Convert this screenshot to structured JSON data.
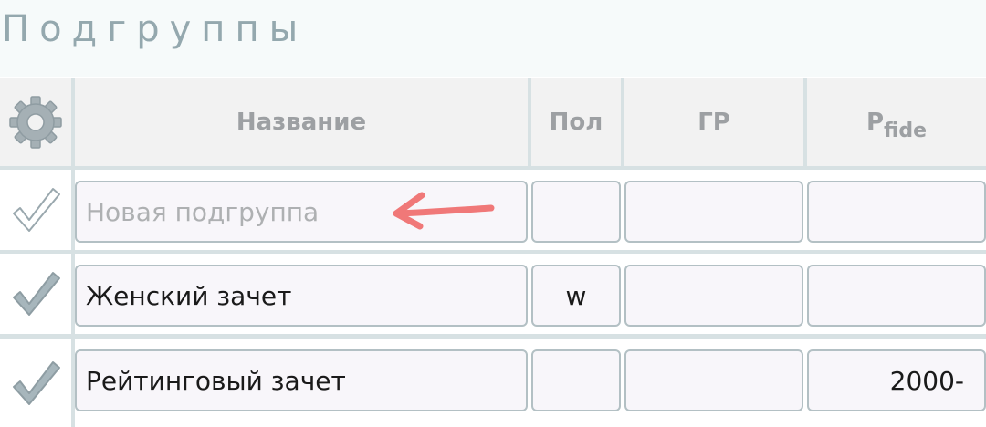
{
  "page": {
    "title": "Подгруппы"
  },
  "table": {
    "headers": {
      "settings_icon": "gear-icon",
      "name": "Название",
      "gender": "Пол",
      "birth_year": "ГР",
      "rating_main": "P",
      "rating_sub": "fide"
    },
    "rows": [
      {
        "enabled": false,
        "name": "",
        "name_placeholder": "Новая подгруппа",
        "gender": "",
        "birth_year": "",
        "rating": ""
      },
      {
        "enabled": true,
        "name": "Женский зачет",
        "gender": "w",
        "birth_year": "",
        "rating": ""
      },
      {
        "enabled": true,
        "name": "Рейтинговый зачет",
        "gender": "",
        "birth_year": "",
        "rating": "2000-"
      }
    ]
  },
  "annotation": {
    "arrow_color": "#f07878"
  },
  "colors": {
    "title": "#94a8ae",
    "header_text": "#9da0a3",
    "grid": "#d7e1e3",
    "field_border": "#b3c0c4",
    "check_active": "#a7b6bc"
  }
}
